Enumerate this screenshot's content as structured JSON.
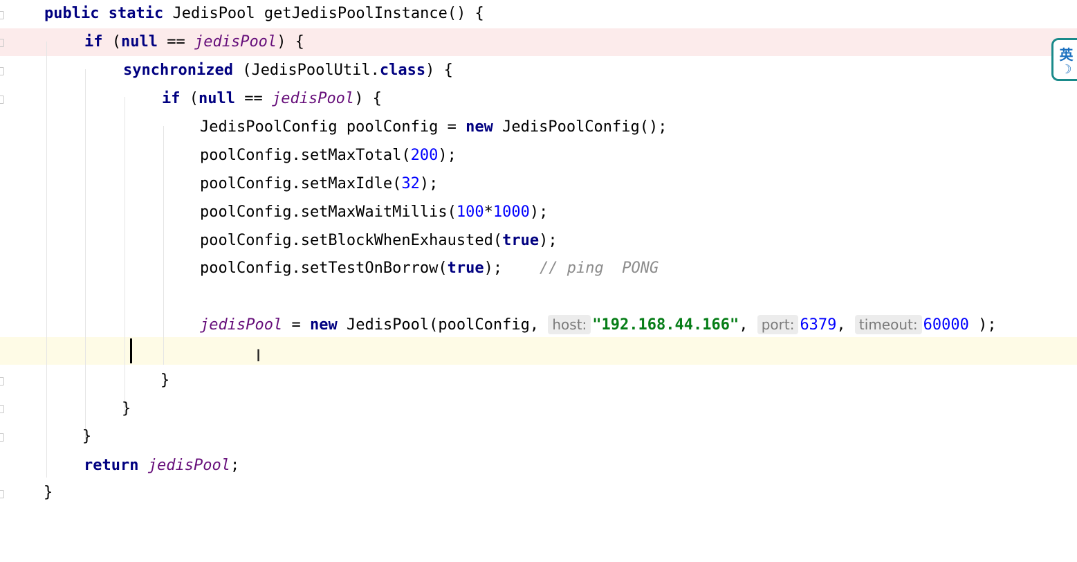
{
  "code": {
    "l1": [
      "public",
      " ",
      "static",
      " JedisPool getJedisPoolInstance() {"
    ],
    "l2": [
      "if",
      " (",
      "null",
      " == ",
      "jedisPool",
      ") {"
    ],
    "l3": [
      "synchronized",
      " (JedisPoolUtil.",
      "class",
      ") {"
    ],
    "l4": [
      "if",
      " (",
      "null",
      " == ",
      "jedisPool",
      ") {"
    ],
    "l5": [
      "JedisPoolConfig poolConfig = ",
      "new",
      " JedisPoolConfig();"
    ],
    "l6": [
      "poolConfig.setMaxTotal(",
      "200",
      ");"
    ],
    "l7": [
      "poolConfig.setMaxIdle(",
      "32",
      ");"
    ],
    "l8": [
      "poolConfig.setMaxWaitMillis(",
      "100",
      "*",
      "1000",
      ");"
    ],
    "l9": [
      "poolConfig.setBlockWhenExhausted(",
      "true",
      ");"
    ],
    "l10": [
      "poolConfig.setTestOnBorrow(",
      "true",
      ");",
      "// ping  PONG"
    ],
    "l12": [
      "jedisPool",
      " = ",
      "new",
      " JedisPool(poolConfig, ",
      "host:",
      "\"192.168.44.166\"",
      ", ",
      "port:",
      "6379",
      ", ",
      "timeout:",
      "60000",
      " );"
    ],
    "l14": "}",
    "l15": "}",
    "l16": "}",
    "l17": [
      "return",
      " ",
      "jedisPool",
      ";"
    ],
    "l18": "}"
  },
  "ime_indicator": {
    "char": "英",
    "moon": "☽"
  },
  "colors": {
    "keyword": "#000080",
    "field": "#660e7a",
    "number": "#0000ff",
    "string": "#067d17",
    "comment": "#8c8c8c",
    "error_line_bg": "#fcebeb",
    "caret_line_bg": "#fefbe6"
  }
}
